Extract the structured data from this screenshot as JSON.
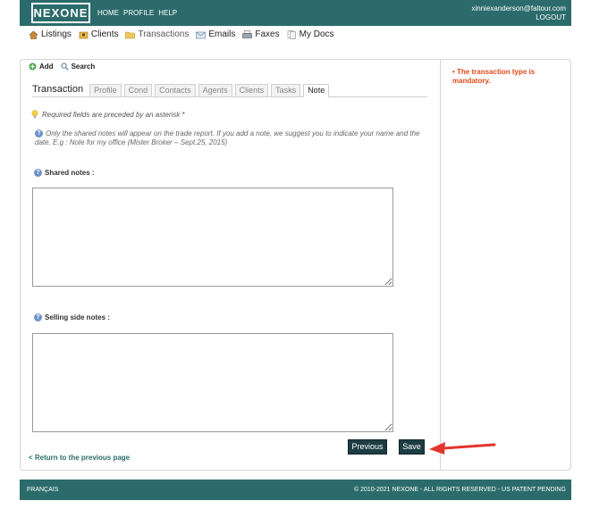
{
  "header": {
    "logo": "NEXONE",
    "nav": [
      "HOME",
      "PROFILE",
      "HELP"
    ],
    "user_email": "xinniexanderson@faltour.com",
    "logout": "LOGOUT"
  },
  "main_nav": [
    {
      "label": "Listings",
      "icon": "house-icon"
    },
    {
      "label": "Clients",
      "icon": "clients-icon"
    },
    {
      "label": "Transactions",
      "icon": "folder-icon"
    },
    {
      "label": "Emails",
      "icon": "envelope-icon"
    },
    {
      "label": "Faxes",
      "icon": "fax-icon"
    },
    {
      "label": "My Docs",
      "icon": "docs-icon"
    }
  ],
  "toolbar": {
    "add": "Add",
    "search": "Search"
  },
  "tabs": [
    "Transaction",
    "Profile",
    "Cond",
    "Contacts",
    "Agents",
    "Clients",
    "Tasks",
    "Note"
  ],
  "active_tab": "Note",
  "hint": "Required fields are preceded by an asterisk *",
  "info": "Only the shared notes will appear on the trade report. If you add a note, we suggest you to indicate your name and the date. E.g : Note for my office (Mister Broker – Sept.25, 2015)",
  "fields": {
    "shared_notes": {
      "label": "Shared notes :",
      "value": ""
    },
    "selling_notes": {
      "label": "Selling side notes :",
      "value": ""
    }
  },
  "buttons": {
    "previous": "Previous",
    "save": "Save"
  },
  "back_link": "< Return to the previous page",
  "error": "The transaction type is mandatory.",
  "footer": {
    "lang": "FRANÇAIS",
    "copyright": "© 2010-2021 NEXONE - ALL RIGHTS RESERVED - US PATENT PENDING"
  },
  "colors": {
    "header": "#2c6b6b",
    "button": "#1e3d43",
    "error": "#e04a1a",
    "arrow": "#e2352f"
  }
}
